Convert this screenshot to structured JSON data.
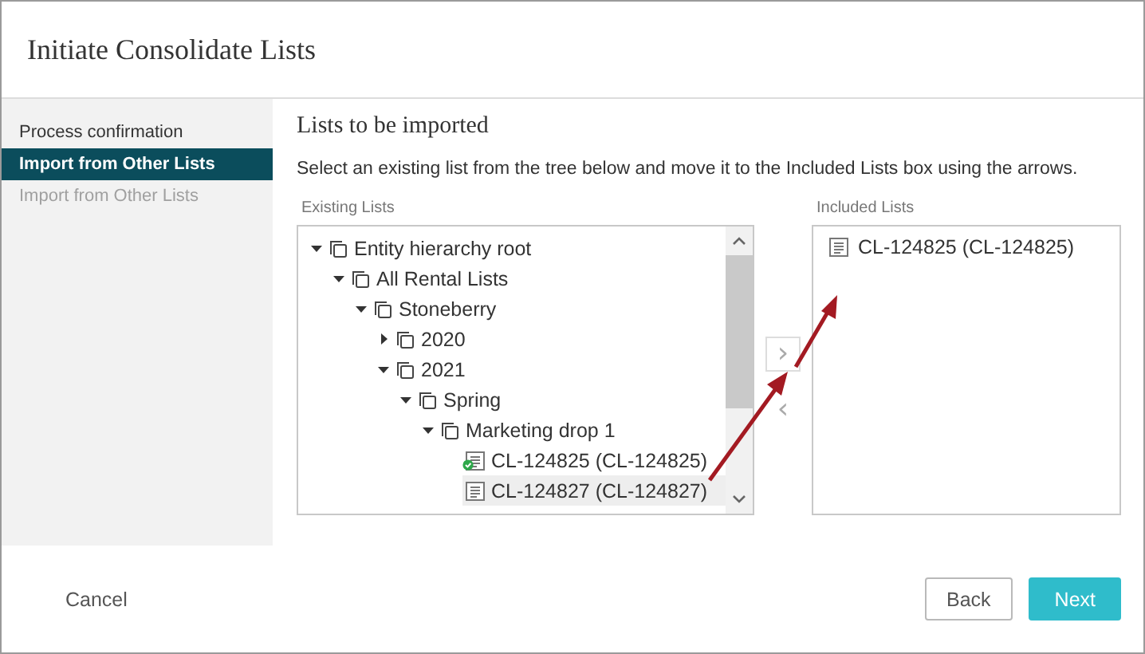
{
  "dialog": {
    "title": "Initiate Consolidate Lists"
  },
  "steps": [
    {
      "label": "Process confirmation",
      "selected": false,
      "disabled": false
    },
    {
      "label": "Import from Other Lists",
      "selected": true,
      "disabled": false
    },
    {
      "label": "Import from Other Lists",
      "selected": false,
      "disabled": true
    }
  ],
  "section": {
    "heading": "Lists to be imported",
    "instructions": "Select an existing list from the tree below and move it to the Included Lists box using the arrows."
  },
  "existing_lists": {
    "label": "Existing Lists",
    "tree": [
      {
        "label": "Entity hierarchy root",
        "kind": "folder",
        "expanded": true,
        "selected": false,
        "children": [
          {
            "label": "All Rental Lists",
            "kind": "folder",
            "expanded": true,
            "selected": false,
            "children": [
              {
                "label": "Stoneberry",
                "kind": "folder",
                "expanded": true,
                "selected": false,
                "children": [
                  {
                    "label": "2020",
                    "kind": "folder",
                    "expanded": false,
                    "selected": false
                  },
                  {
                    "label": "2021",
                    "kind": "folder",
                    "expanded": true,
                    "selected": false,
                    "children": [
                      {
                        "label": "Spring",
                        "kind": "folder",
                        "expanded": true,
                        "selected": false,
                        "children": [
                          {
                            "label": "Marketing drop 1",
                            "kind": "folder",
                            "expanded": true,
                            "selected": false,
                            "children": [
                              {
                                "label": "CL-124825 (CL-124825)",
                                "kind": "list",
                                "included": true,
                                "selected": false
                              },
                              {
                                "label": "CL-124827 (CL-124827)",
                                "kind": "list",
                                "included": false,
                                "selected": true
                              }
                            ]
                          }
                        ]
                      }
                    ]
                  }
                ]
              }
            ]
          }
        ]
      }
    ]
  },
  "move_buttons": [
    {
      "symbol": "›",
      "disabled": false
    },
    {
      "symbol": "‹",
      "disabled": true
    }
  ],
  "included_lists": {
    "label": "Included Lists",
    "items": [
      {
        "label": "CL-124825 (CL-124825)"
      }
    ]
  },
  "footer": {
    "cancel": "Cancel",
    "back": "Back",
    "next": "Next"
  }
}
